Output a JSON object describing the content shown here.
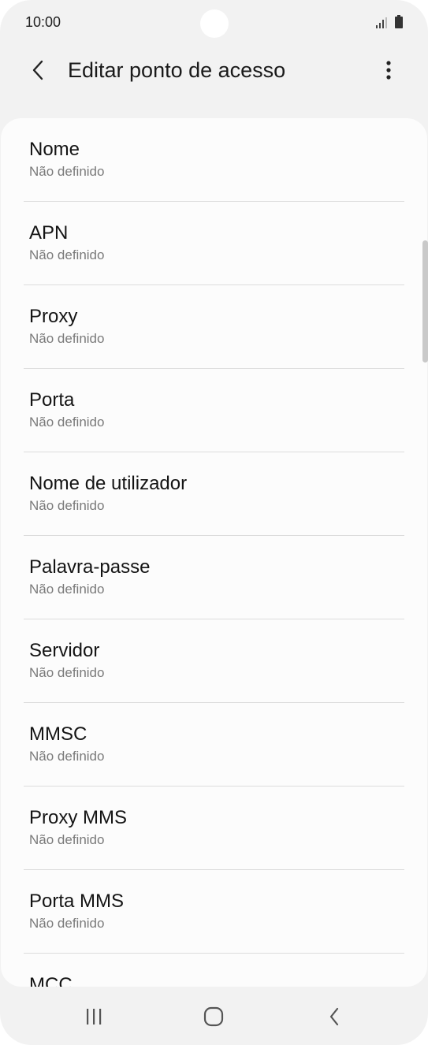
{
  "status_bar": {
    "time": "10:00"
  },
  "header": {
    "title": "Editar ponto de acesso"
  },
  "icons": {
    "back": "chevron-left-icon",
    "more": "more-vertical-icon",
    "signal": "signal-icon",
    "battery": "battery-icon",
    "recent_apps": "recent-apps-icon",
    "home": "home-icon",
    "nav_back": "back-icon"
  },
  "settings": {
    "items": [
      {
        "title": "Nome",
        "value": "Não definido"
      },
      {
        "title": "APN",
        "value": "Não definido"
      },
      {
        "title": "Proxy",
        "value": "Não definido"
      },
      {
        "title": "Porta",
        "value": "Não definido"
      },
      {
        "title": "Nome de utilizador",
        "value": "Não definido"
      },
      {
        "title": "Palavra-passe",
        "value": "Não definido"
      },
      {
        "title": "Servidor",
        "value": "Não definido"
      },
      {
        "title": "MMSC",
        "value": "Não definido"
      },
      {
        "title": "Proxy MMS",
        "value": "Não definido"
      },
      {
        "title": "Porta MMS",
        "value": "Não definido"
      },
      {
        "title": "MCC",
        "value": ""
      }
    ]
  },
  "colors": {
    "background": "#f2f2f2",
    "card": "#fcfcfc",
    "divider": "#dcdcdc",
    "title_text": "#141414",
    "secondary_text": "#7a7a7a"
  }
}
